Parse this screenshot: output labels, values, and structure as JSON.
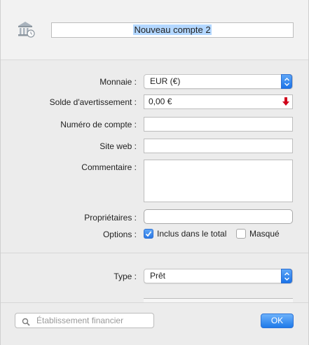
{
  "account": {
    "name": "Nouveau compte 2"
  },
  "form": {
    "currency_label": "Monnaie :",
    "currency_value": "EUR (€)",
    "warning_balance_label": "Solde d'avertissement :",
    "warning_balance_value": "0,00 €",
    "account_number_label": "Numéro de compte :",
    "account_number_value": "",
    "website_label": "Site web :",
    "website_value": "",
    "comment_label": "Commentaire :",
    "comment_value": "",
    "owners_label": "Propriétaires :",
    "options_label": "Options :",
    "option_included_label": "Inclus dans le total",
    "option_included_checked": true,
    "option_hidden_label": "Masqué",
    "option_hidden_checked": false,
    "type_label": "Type :",
    "type_value": "Prêt"
  },
  "footer": {
    "search_placeholder": "Établissement financier",
    "ok_label": "OK"
  },
  "colors": {
    "accent": "#1f7ae9",
    "warning_arrow": "#d0021b",
    "selection": "#b3d7ff"
  },
  "icons": [
    "bank-icon",
    "stepper-icon",
    "down-arrow-icon",
    "checkmark-icon",
    "search-icon"
  ]
}
